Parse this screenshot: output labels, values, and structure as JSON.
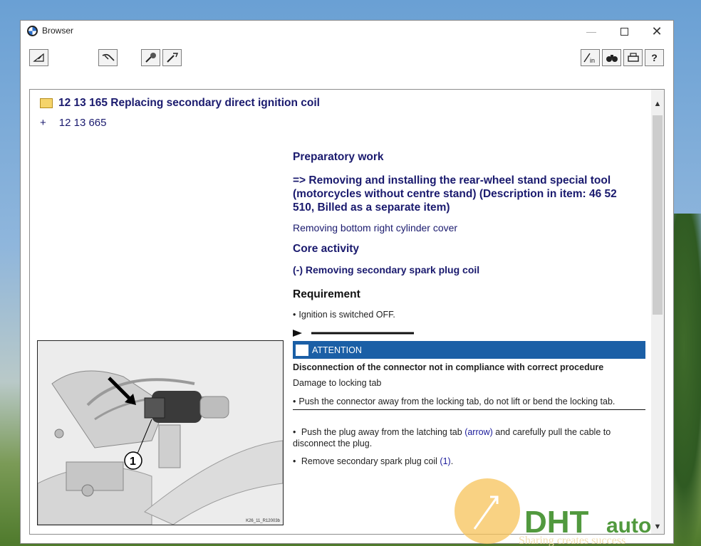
{
  "window": {
    "title": "Browser"
  },
  "toolbar": {
    "left_buttons": [
      {
        "name": "back-icon"
      },
      {
        "name": "motorcycle-icon"
      },
      {
        "name": "tool-icon"
      },
      {
        "name": "wrench-icon"
      }
    ],
    "right_buttons": [
      {
        "name": "edit-in-icon"
      },
      {
        "name": "binoculars-icon"
      },
      {
        "name": "print-icon"
      },
      {
        "name": "help-icon"
      }
    ]
  },
  "document": {
    "title": "12 13 165 Replacing secondary direct ignition coil",
    "sub_item_prefix": "+",
    "sub_item": "12 13 665",
    "preparatory_heading": "Preparatory work",
    "preparatory_link": "=> Removing and installing the rear-wheel stand special tool (motorcycles without centre stand) (Description in item: 46 52 510, Billed as a separate item)",
    "removing_cover": "Removing bottom right cylinder cover",
    "core_heading": "Core activity",
    "core_step": "(-) Removing secondary spark plug coil",
    "requirement_heading": "Requirement",
    "requirement_item": "Ignition is switched OFF.",
    "attention_label": "ATTENTION",
    "attention_bold": "Disconnection of the connector not in compliance with correct procedure",
    "attention_damage": "Damage to locking tab",
    "attention_bullet": "Push the connector away from the locking tab, do not lift or bend the locking tab.",
    "step1_pre": "Push the plug away from the latching tab ",
    "step1_link": "(arrow)",
    "step1_post": " and carefully pull the cable to disconnect the plug.",
    "step2_pre": "Remove secondary spark plug coil ",
    "step2_link": "(1)",
    "step2_post": ".",
    "figure_callout": "1",
    "figure_caption": "K26_11_R12003b"
  },
  "watermark": {
    "brand": "DHT auto",
    "tagline": "Sharing creates success"
  },
  "colors": {
    "heading_blue": "#1a1a6e",
    "attention_bar": "#1b5fa6"
  }
}
